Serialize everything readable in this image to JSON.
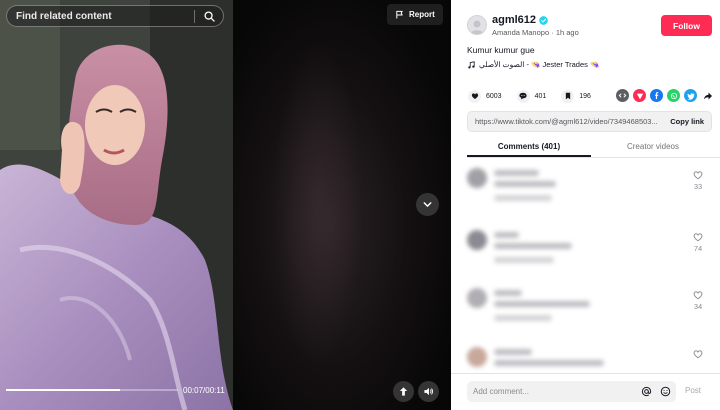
{
  "video": {
    "search_placeholder": "Find related content",
    "report_label": "Report",
    "time_readout": "00:07/00:11",
    "progress_fraction": 0.66
  },
  "author": {
    "handle": "agml612",
    "display_name": "Amanda Manopo",
    "posted_ago": "1h ago",
    "follow_label": "Follow"
  },
  "post": {
    "caption": "Kumur kumur gue",
    "music": "الصوت الأصلي - 👒 Jester Trades 👒"
  },
  "stats": {
    "likes": "6003",
    "comments": "401",
    "saves": "196"
  },
  "share_icons": [
    "embed-icon",
    "send-icon",
    "facebook-icon",
    "whatsapp-icon",
    "twitter-icon",
    "share-arrow-icon"
  ],
  "link": {
    "url": "https://www.tiktok.com/@agml612/video/7349468503...",
    "copy_label": "Copy link"
  },
  "tabs": [
    {
      "label": "Comments (401)",
      "active": true
    },
    {
      "label": "Creator videos",
      "active": false
    }
  ],
  "comments": [
    {
      "likes": "33"
    },
    {
      "likes": "74"
    },
    {
      "likes": "34"
    },
    {
      "likes": ""
    }
  ],
  "comment_bar": {
    "placeholder": "Add comment...",
    "post_label": "Post"
  },
  "colors": {
    "accent": "#fe2c55",
    "verified": "#20d5ec",
    "text_primary": "#161823",
    "text_secondary": "#57585d"
  }
}
